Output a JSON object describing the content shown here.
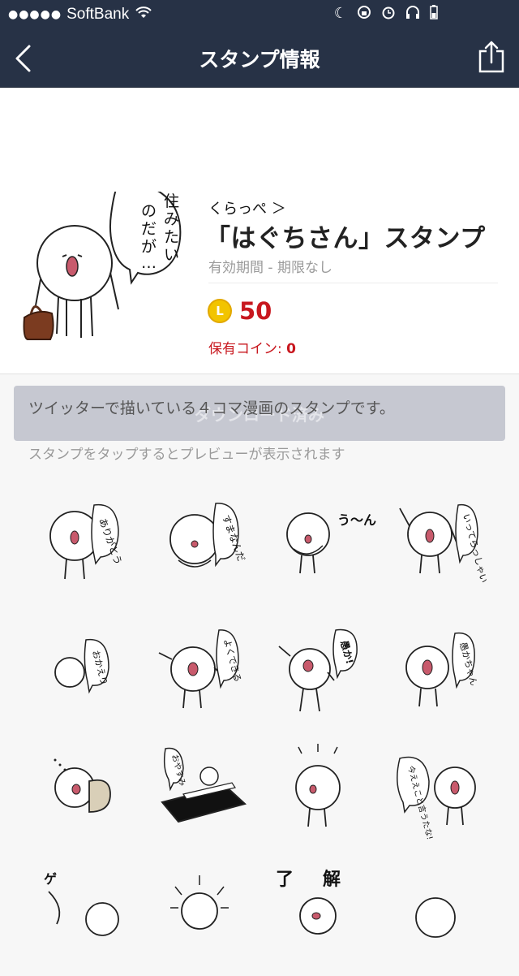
{
  "status": {
    "dots": "●●●●●",
    "carrier": "SoftBank"
  },
  "nav": {
    "title": "スタンプ情報"
  },
  "product": {
    "author": "くらっぺ ＞",
    "title": "「はぐちさん」スタンプ",
    "validity": "有効期間 - 期限なし",
    "coin_letter": "L",
    "price": "50",
    "owned_label": "保有コイン: ",
    "owned_value": "0",
    "hero_bubble": "住みたいのだが…"
  },
  "download": {
    "label": "ダウンロード済み"
  },
  "description": "ツイッターで描いている４コマ漫画のスタンプです。",
  "hint": "スタンプをタップするとプレビューが表示されます",
  "stickers": [
    {
      "bubble": "ありがとう"
    },
    {
      "bubble": "すまなんだ"
    },
    {
      "bubble": "う〜ん"
    },
    {
      "bubble": "いってらっしゃい"
    },
    {
      "bubble": "おかえり"
    },
    {
      "bubble": "よくできる"
    },
    {
      "bubble": "愚か!"
    },
    {
      "bubble": "愚かちゃん"
    },
    {
      "bubble": ""
    },
    {
      "bubble": "おやすみ"
    },
    {
      "bubble": ""
    },
    {
      "bubble": "今ええこと言うたな!"
    },
    {
      "bubble": "ゲ"
    },
    {
      "bubble": ""
    },
    {
      "bubble": "了解"
    },
    {
      "bubble": ""
    }
  ],
  "colors": {
    "navbar": "#273246",
    "accent_red": "#c8171e",
    "coin": "#f2c400",
    "button_disabled": "#c6c8d1"
  }
}
